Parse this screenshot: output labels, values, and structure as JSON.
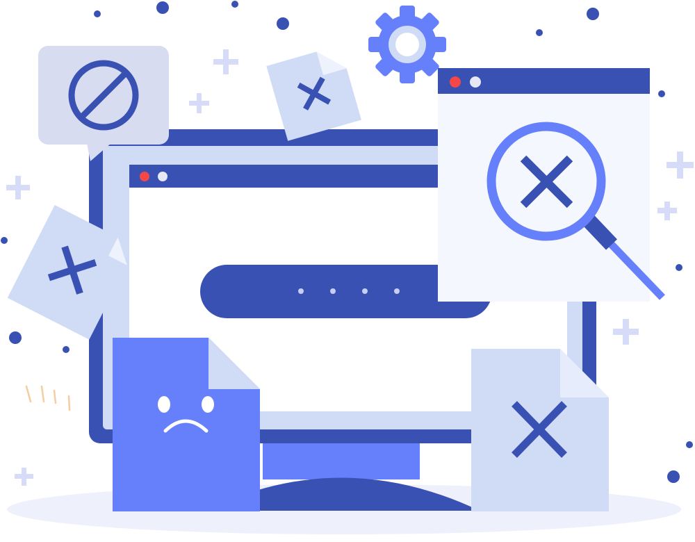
{
  "illustration": {
    "subject": "error-not-found",
    "colors": {
      "dark_blue": "#3a51b4",
      "mid_blue": "#6680fb",
      "light_blue": "#d0dbf6",
      "pale_blue": "#f4f7fd",
      "ground": "#eef0fb",
      "window_dot_red": "#f44747",
      "window_dot_white": "#e6e9f5",
      "sparkle": "#f4cda0",
      "plus_sign": "#d6dcf7"
    },
    "icons": {
      "forbidden": "forbidden-icon",
      "settings": "gear-icon",
      "search_error": "magnifier-x-icon",
      "sad_file": "sad-document-icon",
      "error_file": "document-x-icon"
    }
  }
}
